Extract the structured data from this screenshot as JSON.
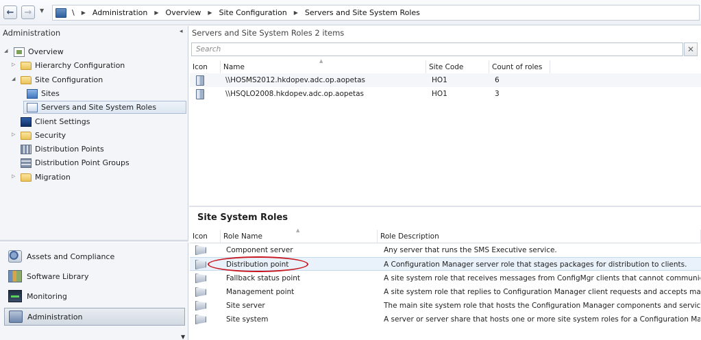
{
  "breadcrumb": {
    "root": "\\",
    "items": [
      "Administration",
      "Overview",
      "Site Configuration",
      "Servers and Site System Roles"
    ]
  },
  "nav": {
    "back": "←",
    "forward": "→",
    "dropdown": "▼",
    "separator": "▶"
  },
  "left_pane": {
    "title": "Administration",
    "collapse": "◂",
    "tree": [
      {
        "label": "Overview",
        "icon": "overview-icon",
        "expanded": true
      },
      {
        "label": "Hierarchy Configuration",
        "icon": "folder-icon"
      },
      {
        "label": "Site Configuration",
        "icon": "folder-icon",
        "expanded": true
      },
      {
        "label": "Sites",
        "icon": "sites-icon"
      },
      {
        "label": "Servers and Site System Roles",
        "icon": "servers-icon",
        "selected": true
      },
      {
        "label": "Client Settings",
        "icon": "client-settings-icon"
      },
      {
        "label": "Security",
        "icon": "folder-icon"
      },
      {
        "label": "Distribution Points",
        "icon": "distribution-points-icon"
      },
      {
        "label": "Distribution Point Groups",
        "icon": "distribution-point-groups-icon"
      },
      {
        "label": "Migration",
        "icon": "folder-icon"
      }
    ],
    "workspaces": [
      {
        "label": "Assets and Compliance",
        "icon": "assets-icon"
      },
      {
        "label": "Software Library",
        "icon": "software-library-icon"
      },
      {
        "label": "Monitoring",
        "icon": "monitoring-icon"
      },
      {
        "label": "Administration",
        "icon": "administration-icon",
        "active": true
      }
    ]
  },
  "servers": {
    "title": "Servers and Site System Roles 2 items",
    "search_placeholder": "Search",
    "clear": "✕",
    "columns": [
      "Icon",
      "Name",
      "Site Code",
      "Count of roles"
    ],
    "rows": [
      {
        "name": "\\\\HOSMS2012.hkdopev.adc.op.aopetas",
        "site_code": "HO1",
        "count": "6"
      },
      {
        "name": "\\\\HSQLO2008.hkdopev.adc.op.aopetas",
        "site_code": "HO1",
        "count": "3"
      }
    ]
  },
  "roles": {
    "title": "Site System Roles",
    "columns": [
      "Icon",
      "Role Name",
      "Role Description"
    ],
    "rows": [
      {
        "name": "Component server",
        "description": "Any server that runs the SMS Executive service."
      },
      {
        "name": "Distribution point",
        "description": "A Configuration Manager server role that stages packages for distribution to clients.",
        "selected": true
      },
      {
        "name": "Fallback status point",
        "description": "A site system role that receives messages from ConfigMgr clients that cannot communicat..."
      },
      {
        "name": "Management point",
        "description": "A site system role that replies to Configuration Manager client requests and accepts mana..."
      },
      {
        "name": "Site server",
        "description": "The main site system role that hosts the Configuration Manager components and services."
      },
      {
        "name": "Site system",
        "description": "A server or server share that hosts one or more site system roles for a Configuration Man..."
      }
    ]
  },
  "colors": {
    "highlight_ellipse": "#c8141c",
    "selection": "#e9f1fb"
  }
}
